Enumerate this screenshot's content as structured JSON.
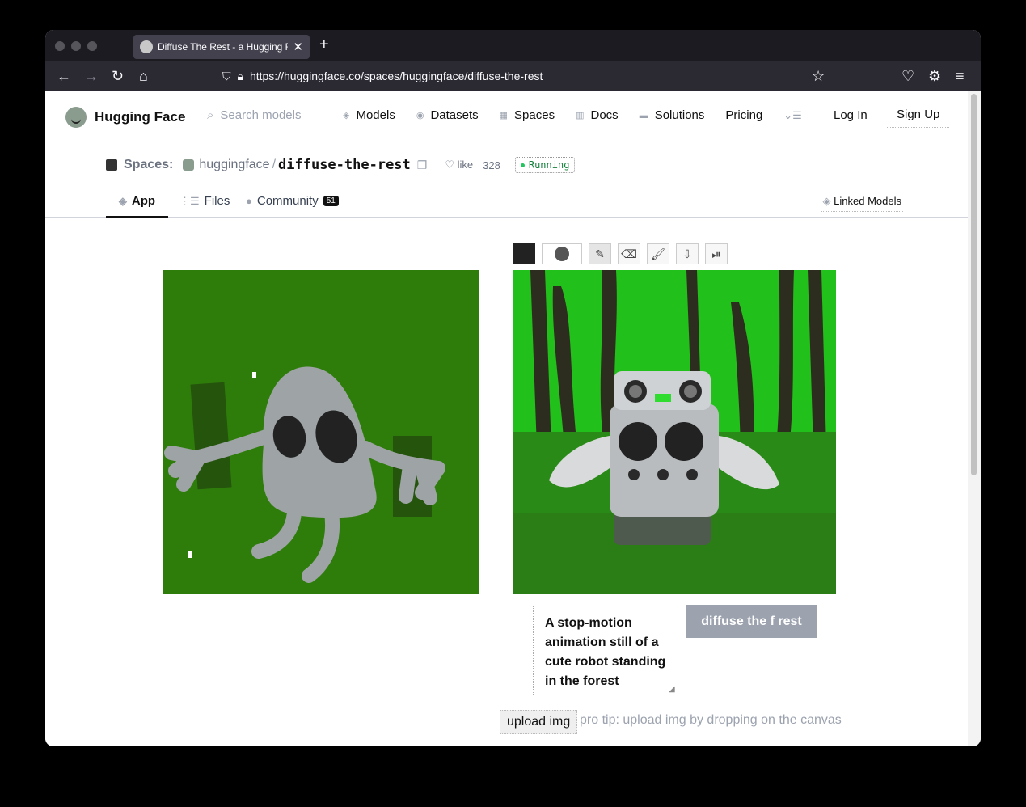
{
  "browser": {
    "tab_title": "Diffuse The Rest - a Hugging Fa",
    "tab_close": "✕",
    "new_tab": "+",
    "url": "https://huggingface.co/spaces/huggingface/diffuse-the-rest"
  },
  "header": {
    "logo_text": "Hugging Face",
    "search_placeholder": "Search models",
    "nav": [
      "Models",
      "Datasets",
      "Spaces",
      "Docs",
      "Solutions",
      "Pricing"
    ],
    "login": "Log In",
    "signup": "Sign Up"
  },
  "space": {
    "label": "Spaces:",
    "owner": "huggingface",
    "separator": "/",
    "name": "diffuse-the-rest",
    "like_label": "like",
    "like_count": "328",
    "status": "Running"
  },
  "tabs": {
    "app": "App",
    "files": "Files",
    "community": "Community",
    "community_count": "51",
    "linked_models": "Linked Models"
  },
  "app": {
    "prompt": "A stop-motion animation still of a cute robot standing in the forest",
    "diffuse_button": "diffuse the f rest",
    "upload_button": "upload img",
    "pro_tip": "pro tip: upload img by dropping on the canvas",
    "colors": {
      "canvas_bg": "#2e7d0a",
      "doodle": "#9ea3a6",
      "brush": "#222222",
      "button_disabled": "#9ca3af"
    }
  },
  "icons": {
    "back": "arrow-left-icon",
    "forward": "arrow-right-icon",
    "reload": "reload-icon",
    "home": "home-icon",
    "shield": "shield-icon",
    "lock": "lock-icon",
    "bookmark": "star-icon",
    "pocket": "pocket-icon",
    "extensions": "gear-icon",
    "menu": "hamburger-icon"
  }
}
